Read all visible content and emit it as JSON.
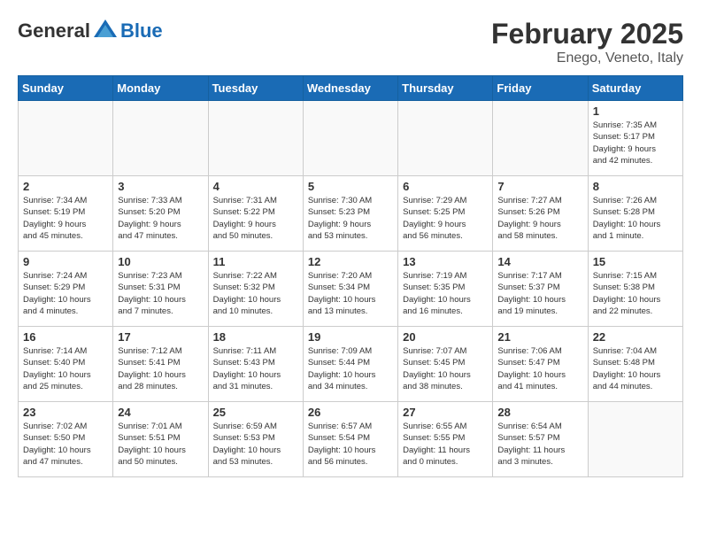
{
  "header": {
    "logo": {
      "general": "General",
      "blue": "Blue"
    },
    "title": "February 2025",
    "location": "Enego, Veneto, Italy"
  },
  "weekdays": [
    "Sunday",
    "Monday",
    "Tuesday",
    "Wednesday",
    "Thursday",
    "Friday",
    "Saturday"
  ],
  "weeks": [
    [
      {
        "day": "",
        "info": ""
      },
      {
        "day": "",
        "info": ""
      },
      {
        "day": "",
        "info": ""
      },
      {
        "day": "",
        "info": ""
      },
      {
        "day": "",
        "info": ""
      },
      {
        "day": "",
        "info": ""
      },
      {
        "day": "1",
        "info": "Sunrise: 7:35 AM\nSunset: 5:17 PM\nDaylight: 9 hours\nand 42 minutes."
      }
    ],
    [
      {
        "day": "2",
        "info": "Sunrise: 7:34 AM\nSunset: 5:19 PM\nDaylight: 9 hours\nand 45 minutes."
      },
      {
        "day": "3",
        "info": "Sunrise: 7:33 AM\nSunset: 5:20 PM\nDaylight: 9 hours\nand 47 minutes."
      },
      {
        "day": "4",
        "info": "Sunrise: 7:31 AM\nSunset: 5:22 PM\nDaylight: 9 hours\nand 50 minutes."
      },
      {
        "day": "5",
        "info": "Sunrise: 7:30 AM\nSunset: 5:23 PM\nDaylight: 9 hours\nand 53 minutes."
      },
      {
        "day": "6",
        "info": "Sunrise: 7:29 AM\nSunset: 5:25 PM\nDaylight: 9 hours\nand 56 minutes."
      },
      {
        "day": "7",
        "info": "Sunrise: 7:27 AM\nSunset: 5:26 PM\nDaylight: 9 hours\nand 58 minutes."
      },
      {
        "day": "8",
        "info": "Sunrise: 7:26 AM\nSunset: 5:28 PM\nDaylight: 10 hours\nand 1 minute."
      }
    ],
    [
      {
        "day": "9",
        "info": "Sunrise: 7:24 AM\nSunset: 5:29 PM\nDaylight: 10 hours\nand 4 minutes."
      },
      {
        "day": "10",
        "info": "Sunrise: 7:23 AM\nSunset: 5:31 PM\nDaylight: 10 hours\nand 7 minutes."
      },
      {
        "day": "11",
        "info": "Sunrise: 7:22 AM\nSunset: 5:32 PM\nDaylight: 10 hours\nand 10 minutes."
      },
      {
        "day": "12",
        "info": "Sunrise: 7:20 AM\nSunset: 5:34 PM\nDaylight: 10 hours\nand 13 minutes."
      },
      {
        "day": "13",
        "info": "Sunrise: 7:19 AM\nSunset: 5:35 PM\nDaylight: 10 hours\nand 16 minutes."
      },
      {
        "day": "14",
        "info": "Sunrise: 7:17 AM\nSunset: 5:37 PM\nDaylight: 10 hours\nand 19 minutes."
      },
      {
        "day": "15",
        "info": "Sunrise: 7:15 AM\nSunset: 5:38 PM\nDaylight: 10 hours\nand 22 minutes."
      }
    ],
    [
      {
        "day": "16",
        "info": "Sunrise: 7:14 AM\nSunset: 5:40 PM\nDaylight: 10 hours\nand 25 minutes."
      },
      {
        "day": "17",
        "info": "Sunrise: 7:12 AM\nSunset: 5:41 PM\nDaylight: 10 hours\nand 28 minutes."
      },
      {
        "day": "18",
        "info": "Sunrise: 7:11 AM\nSunset: 5:43 PM\nDaylight: 10 hours\nand 31 minutes."
      },
      {
        "day": "19",
        "info": "Sunrise: 7:09 AM\nSunset: 5:44 PM\nDaylight: 10 hours\nand 34 minutes."
      },
      {
        "day": "20",
        "info": "Sunrise: 7:07 AM\nSunset: 5:45 PM\nDaylight: 10 hours\nand 38 minutes."
      },
      {
        "day": "21",
        "info": "Sunrise: 7:06 AM\nSunset: 5:47 PM\nDaylight: 10 hours\nand 41 minutes."
      },
      {
        "day": "22",
        "info": "Sunrise: 7:04 AM\nSunset: 5:48 PM\nDaylight: 10 hours\nand 44 minutes."
      }
    ],
    [
      {
        "day": "23",
        "info": "Sunrise: 7:02 AM\nSunset: 5:50 PM\nDaylight: 10 hours\nand 47 minutes."
      },
      {
        "day": "24",
        "info": "Sunrise: 7:01 AM\nSunset: 5:51 PM\nDaylight: 10 hours\nand 50 minutes."
      },
      {
        "day": "25",
        "info": "Sunrise: 6:59 AM\nSunset: 5:53 PM\nDaylight: 10 hours\nand 53 minutes."
      },
      {
        "day": "26",
        "info": "Sunrise: 6:57 AM\nSunset: 5:54 PM\nDaylight: 10 hours\nand 56 minutes."
      },
      {
        "day": "27",
        "info": "Sunrise: 6:55 AM\nSunset: 5:55 PM\nDaylight: 11 hours\nand 0 minutes."
      },
      {
        "day": "28",
        "info": "Sunrise: 6:54 AM\nSunset: 5:57 PM\nDaylight: 11 hours\nand 3 minutes."
      },
      {
        "day": "",
        "info": ""
      }
    ]
  ]
}
